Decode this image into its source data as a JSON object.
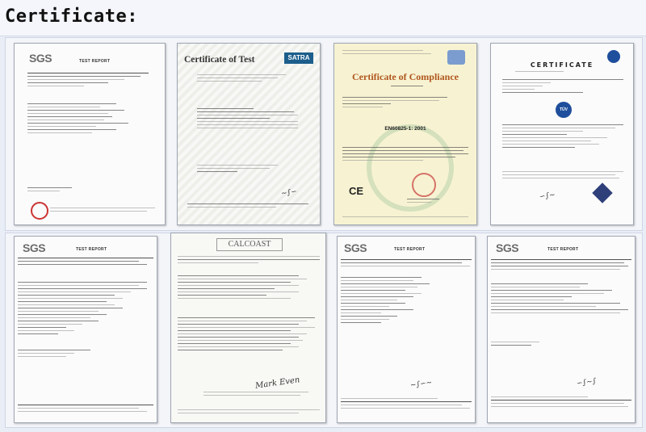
{
  "header": {
    "title": "Certificate:"
  },
  "colors": {
    "page_background": "#e9edf6",
    "header_background": "#f4f6fb",
    "paper": "#fbfbfb",
    "compliance_paper": "#f7f3d2",
    "compliance_title": "#b0561e",
    "tuv_blue": "#1f4e9c"
  },
  "documents": [
    {
      "id": "sgs-test-report-1",
      "logo": "SGS",
      "heading": "TEST REPORT"
    },
    {
      "id": "certificate-of-test",
      "title": "Certificate of Test",
      "logo": "SATRA"
    },
    {
      "id": "certificate-of-compliance",
      "title": "Certificate of Compliance",
      "standard": "EN60825-1: 2001",
      "mark": "CE"
    },
    {
      "id": "tuv-certificate",
      "title": "CERTIFICATE",
      "logo": "TÜV"
    },
    {
      "id": "sgs-test-report-2",
      "logo": "SGS",
      "heading": "TEST REPORT"
    },
    {
      "id": "calcoast-report",
      "logo": "CALCOAST"
    },
    {
      "id": "sgs-test-report-3",
      "logo": "SGS",
      "heading": "TEST REPORT"
    },
    {
      "id": "sgs-test-report-4",
      "logo": "SGS",
      "heading": "TEST REPORT"
    }
  ]
}
